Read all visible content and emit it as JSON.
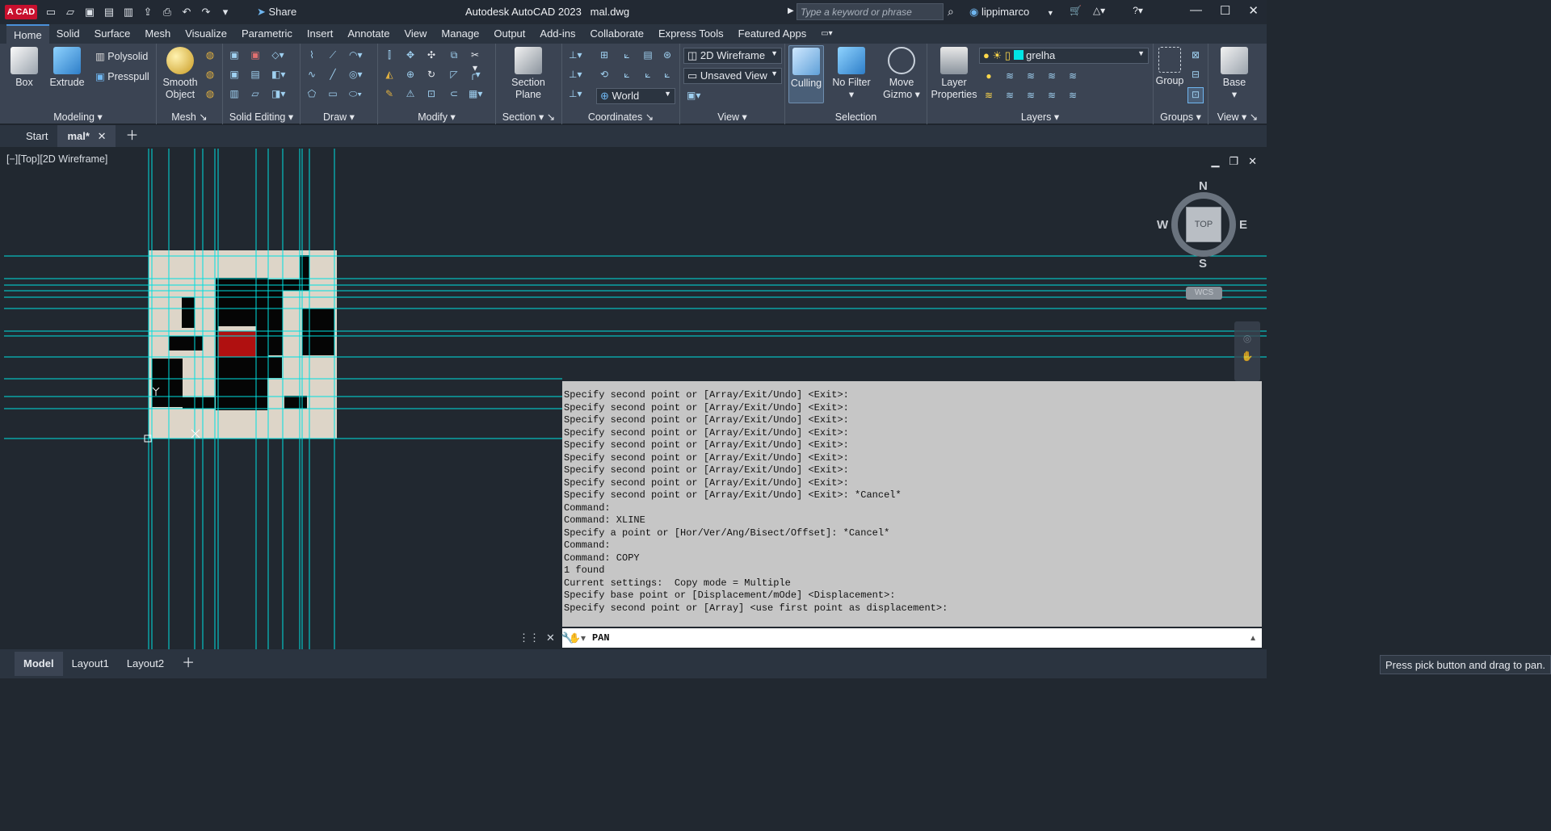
{
  "app": {
    "logo": "A CAD",
    "share": "Share",
    "title": "Autodesk AutoCAD 2023",
    "filename": "mal.dwg",
    "search_placeholder": "Type a keyword or phrase",
    "user": "lippimarco"
  },
  "ribbon_tabs": [
    "Home",
    "Solid",
    "Surface",
    "Mesh",
    "Visualize",
    "Parametric",
    "Insert",
    "Annotate",
    "View",
    "Manage",
    "Output",
    "Add-ins",
    "Collaborate",
    "Express Tools",
    "Featured Apps"
  ],
  "ribbon": {
    "modeling": {
      "label": "Modeling",
      "box": "Box",
      "extrude": "Extrude",
      "polysolid": "Polysolid",
      "presspull": "Presspull"
    },
    "mesh": {
      "label": "Mesh",
      "smooth": "Smooth",
      "object": "Object"
    },
    "solid_editing": {
      "label": "Solid Editing"
    },
    "draw": {
      "label": "Draw"
    },
    "modify": {
      "label": "Modify"
    },
    "section": {
      "label": "Section",
      "section_line1": "Section",
      "section_line2": "Plane"
    },
    "coordinates": {
      "label": "Coordinates",
      "world": "World"
    },
    "view": {
      "label": "View",
      "visual_style": "2D Wireframe",
      "named_view": "Unsaved View"
    },
    "selection": {
      "label": "Selection",
      "culling": "Culling",
      "no_filter": "No Filter",
      "move_line1": "Move",
      "move_line2": "Gizmo"
    },
    "layers": {
      "label": "Layers",
      "props_line1": "Layer",
      "props_line2": "Properties",
      "current_layer": "grelha",
      "layer_color": "#00e5e5"
    },
    "groups": {
      "label": "Groups",
      "group": "Group"
    },
    "view2": {
      "label": "View",
      "base": "Base"
    }
  },
  "doc_tabs": {
    "start": "Start",
    "current": "mal*"
  },
  "viewport": {
    "label": "[−][Top][2D Wireframe]",
    "viewcube": {
      "n": "N",
      "s": "S",
      "e": "E",
      "w": "W",
      "top": "TOP",
      "wcs": "WCS"
    }
  },
  "command_history": [
    "Specify second point or [Array/Exit/Undo] <Exit>:",
    "Specify second point or [Array/Exit/Undo] <Exit>:",
    "Specify second point or [Array/Exit/Undo] <Exit>:",
    "Specify second point or [Array/Exit/Undo] <Exit>:",
    "Specify second point or [Array/Exit/Undo] <Exit>:",
    "Specify second point or [Array/Exit/Undo] <Exit>:",
    "Specify second point or [Array/Exit/Undo] <Exit>:",
    "Specify second point or [Array/Exit/Undo] <Exit>:",
    "Specify second point or [Array/Exit/Undo] <Exit>: *Cancel*",
    "Command:",
    "Command: XLINE",
    "Specify a point or [Hor/Ver/Ang/Bisect/Offset]: *Cancel*",
    "Command:",
    "Command: COPY",
    "1 found",
    "Current settings:  Copy mode = Multiple",
    "Specify base point or [Displacement/mOde] <Displacement>:",
    "Specify second point or [Array] <use first point as displacement>:"
  ],
  "command_input": "PAN",
  "layout_tabs": {
    "model": "Model",
    "layout1": "Layout1",
    "layout2": "Layout2"
  },
  "tooltip": "Press pick button and drag to pan.",
  "colors": {
    "xline": "#00e0e0",
    "ribbon_bg": "#3b4453",
    "viewport_bg": "#212830",
    "red_block": "#b01010"
  }
}
